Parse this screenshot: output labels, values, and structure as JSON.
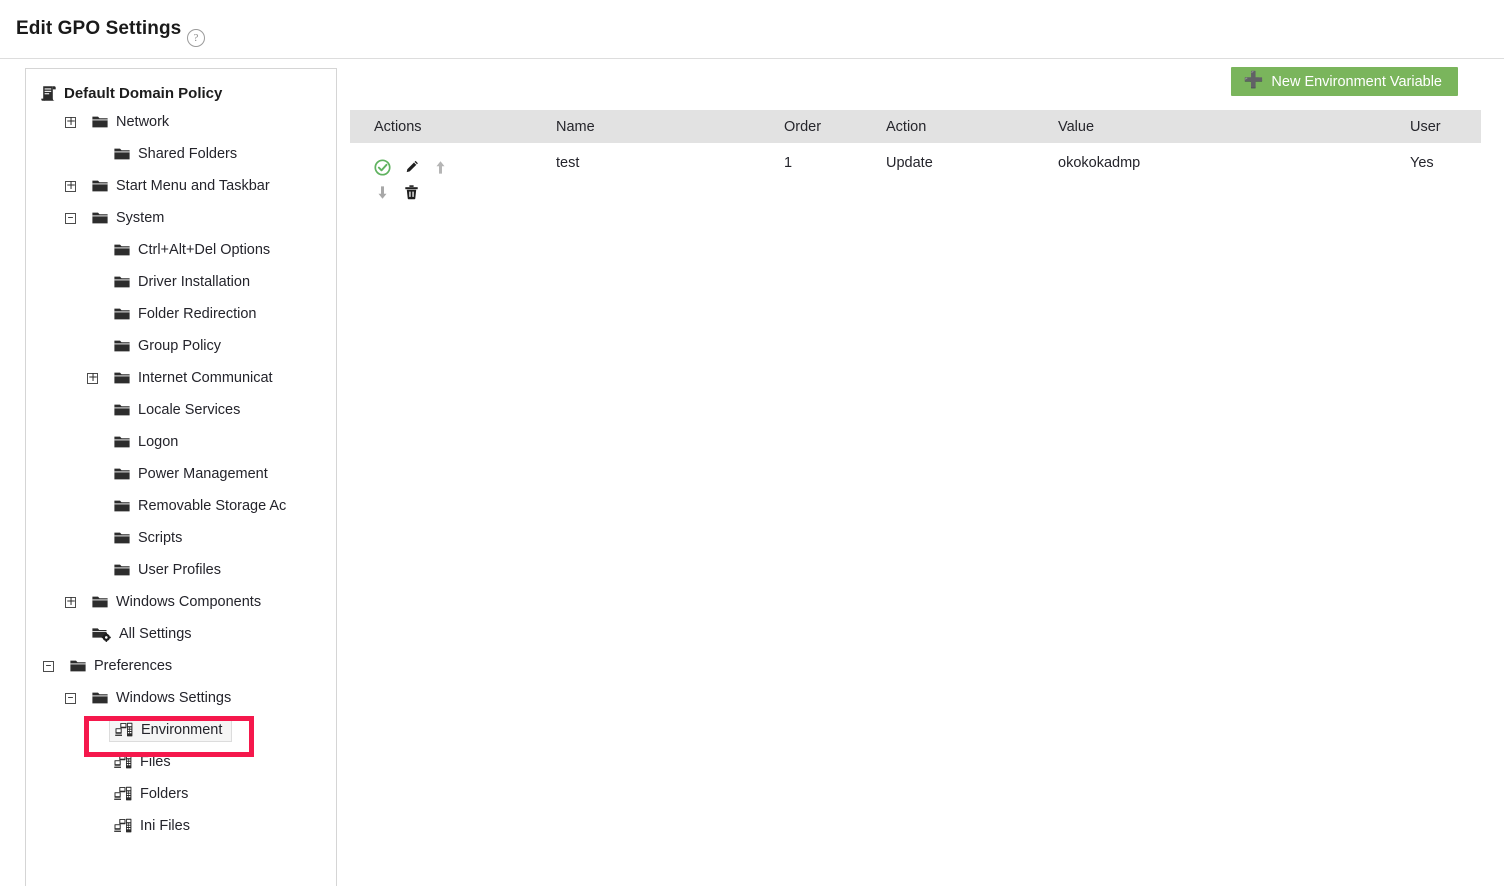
{
  "header": {
    "title": "Edit GPO Settings",
    "help_icon": "help-circle-icon",
    "help_glyph": "?"
  },
  "tree": {
    "root": {
      "label": "Default Domain Policy",
      "icon": "policy-scroll-icon"
    },
    "items": [
      {
        "label": "Network",
        "depth": 1,
        "twisty": "collapsed",
        "icon": "folder-icon"
      },
      {
        "label": "Shared Folders",
        "depth": 2,
        "twisty": "none",
        "icon": "folder-icon"
      },
      {
        "label": "Start Menu and Taskbar",
        "depth": 1,
        "twisty": "collapsed",
        "icon": "folder-icon"
      },
      {
        "label": "System",
        "depth": 1,
        "twisty": "expanded",
        "icon": "folder-icon"
      },
      {
        "label": "Ctrl+Alt+Del Options",
        "depth": 2,
        "twisty": "none",
        "icon": "folder-icon"
      },
      {
        "label": "Driver Installation",
        "depth": 2,
        "twisty": "none",
        "icon": "folder-icon"
      },
      {
        "label": "Folder Redirection",
        "depth": 2,
        "twisty": "none",
        "icon": "folder-icon"
      },
      {
        "label": "Group Policy",
        "depth": 2,
        "twisty": "none",
        "icon": "folder-icon"
      },
      {
        "label": "Internet Communicat",
        "depth": 2,
        "twisty": "collapsed",
        "icon": "folder-icon"
      },
      {
        "label": "Locale Services",
        "depth": 2,
        "twisty": "none",
        "icon": "folder-icon"
      },
      {
        "label": "Logon",
        "depth": 2,
        "twisty": "none",
        "icon": "folder-icon"
      },
      {
        "label": "Power Management",
        "depth": 2,
        "twisty": "none",
        "icon": "folder-icon"
      },
      {
        "label": "Removable Storage Ac",
        "depth": 2,
        "twisty": "none",
        "icon": "folder-icon"
      },
      {
        "label": "Scripts",
        "depth": 2,
        "twisty": "none",
        "icon": "folder-icon"
      },
      {
        "label": "User Profiles",
        "depth": 2,
        "twisty": "none",
        "icon": "folder-icon"
      },
      {
        "label": "Windows Components",
        "depth": 1,
        "twisty": "collapsed",
        "icon": "folder-icon"
      },
      {
        "label": "All Settings",
        "depth": 1,
        "twisty": "none",
        "icon": "folder-gear-icon"
      },
      {
        "label": "Preferences",
        "depth": 0,
        "twisty": "expanded",
        "icon": "folder-icon",
        "highlighted": true
      },
      {
        "label": "Windows Settings",
        "depth": 1,
        "twisty": "expanded",
        "icon": "folder-icon"
      },
      {
        "label": "Environment",
        "depth": 2,
        "twisty": "none",
        "icon": "computers-icon",
        "selected": true
      },
      {
        "label": "Files",
        "depth": 2,
        "twisty": "none",
        "icon": "computers-icon"
      },
      {
        "label": "Folders",
        "depth": 2,
        "twisty": "none",
        "icon": "computers-icon"
      },
      {
        "label": "Ini Files",
        "depth": 2,
        "twisty": "none",
        "icon": "computers-icon"
      }
    ]
  },
  "toolbar": {
    "new_button_label": "New Environment Variable",
    "new_button_icon": "plus-icon",
    "new_button_color": "#7ab55c"
  },
  "table": {
    "columns": [
      "Actions",
      "Name",
      "Order",
      "Action",
      "Value",
      "User"
    ],
    "rows": [
      {
        "name": "test",
        "order": "1",
        "action": "Update",
        "value": "okokokadmp",
        "user": "Yes",
        "actions": [
          "enable-check-icon",
          "edit-pencil-icon",
          "move-up-icon",
          "move-down-icon",
          "delete-trash-icon"
        ]
      }
    ]
  },
  "colors": {
    "accent_green": "#7ab55c",
    "check_green": "#5cb85c",
    "header_gray": "#e2e2e2",
    "highlight_red": "#f5184c",
    "arrow_gray": "#b3b3b3"
  }
}
